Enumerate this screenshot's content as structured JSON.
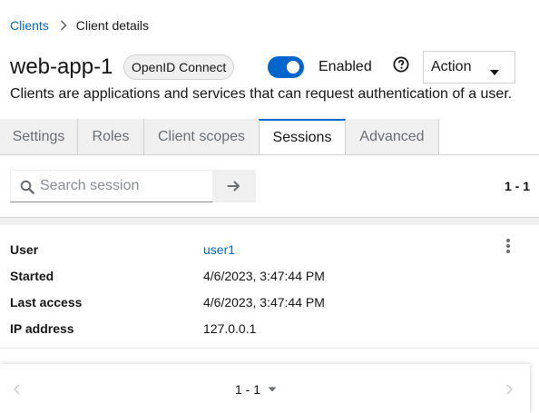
{
  "breadcrumb": {
    "parent": "Clients",
    "current": "Client details"
  },
  "header": {
    "title": "web-app-1",
    "protocol_badge": "OpenID Connect",
    "enabled_label": "Enabled",
    "enabled": true,
    "action_label": "Action",
    "description": "Clients are applications and services that can request authentication of a user."
  },
  "tabs": [
    {
      "label": "Settings",
      "active": false
    },
    {
      "label": "Roles",
      "active": false
    },
    {
      "label": "Client scopes",
      "active": false
    },
    {
      "label": "Sessions",
      "active": true
    },
    {
      "label": "Advanced",
      "active": false
    }
  ],
  "toolbar": {
    "search_placeholder": "Search session",
    "search_value": "",
    "pagination_range": "1 - 1"
  },
  "session": {
    "rows": [
      {
        "key": "User",
        "value": "user1",
        "link": true
      },
      {
        "key": "Started",
        "value": "4/6/2023, 3:47:44 PM",
        "link": false
      },
      {
        "key": "Last access",
        "value": "4/6/2023, 3:47:44 PM",
        "link": false
      },
      {
        "key": "IP address",
        "value": "127.0.0.1",
        "link": false
      }
    ]
  },
  "pagination": {
    "range": "1 - 1"
  },
  "icons": {
    "breadcrumb_separator": "chevron-right-icon",
    "help": "question-circle-icon",
    "action_caret": "caret-down-icon",
    "search": "search-icon",
    "search_submit": "arrow-right-icon",
    "kebab": "kebab-icon",
    "prev": "angle-left-icon",
    "next": "angle-right-icon"
  },
  "colors": {
    "accent": "#0066cc",
    "text": "#151515",
    "muted": "#6a6e73",
    "tab_inactive_bg": "#f0f0f0"
  }
}
